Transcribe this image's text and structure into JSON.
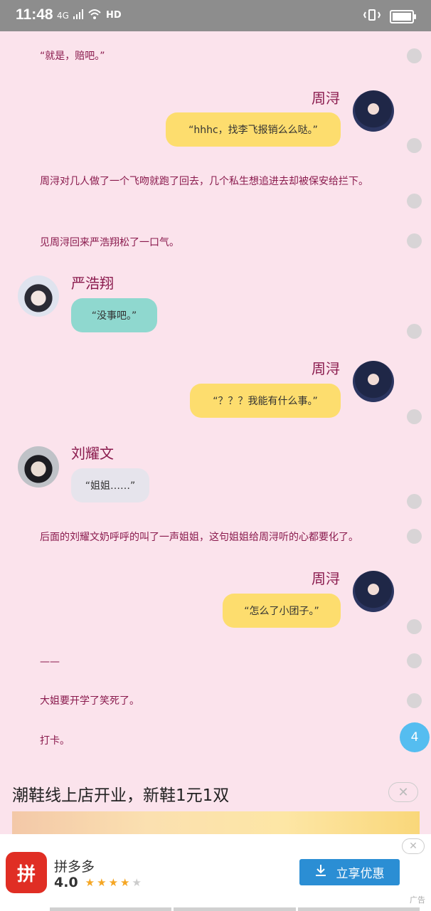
{
  "status_bar": {
    "time": "11:48",
    "network": "4G",
    "hd": "HD"
  },
  "story": {
    "lines": [
      "“就是，赔吧。”",
      "周浔对几人做了一个飞吻就跑了回去，几个私生想追进去却被保安给拦下。",
      "见周浔回来严浩翔松了一口气。",
      "后面的刘耀文奶呼呼的叫了一声姐姐，这句姐姐给周浔听的心都要化了。",
      "——",
      "大姐要开学了笑死了。",
      "打卡。"
    ],
    "chats": [
      {
        "name": "周浔",
        "text": "“hhhc，找李飞报销么么哒。”"
      },
      {
        "name": "严浩翔",
        "text": "“没事吧。”"
      },
      {
        "name": "周浔",
        "text": "“？？？我能有什么事。”"
      },
      {
        "name": "刘耀文",
        "text": "“姐姐……”"
      },
      {
        "name": "周浔",
        "text": "“怎么了小团子。”"
      }
    ]
  },
  "page_badge": "4",
  "ad": {
    "title": "潮鞋线上店开业，新鞋1元1双",
    "close": "✕",
    "app_name": "拼多多",
    "rating": "4.0",
    "stars_on": "★★★★",
    "stars_off": "★",
    "button": "立享优惠",
    "tag": "广告",
    "logo_text": "拼"
  },
  "colors": {
    "background": "#fbe3ec",
    "text": "#8a1a4d",
    "yellow_bubble": "#fddd6e",
    "teal_bubble": "#8fd8cf",
    "grey_bubble": "#e6e4ec"
  }
}
